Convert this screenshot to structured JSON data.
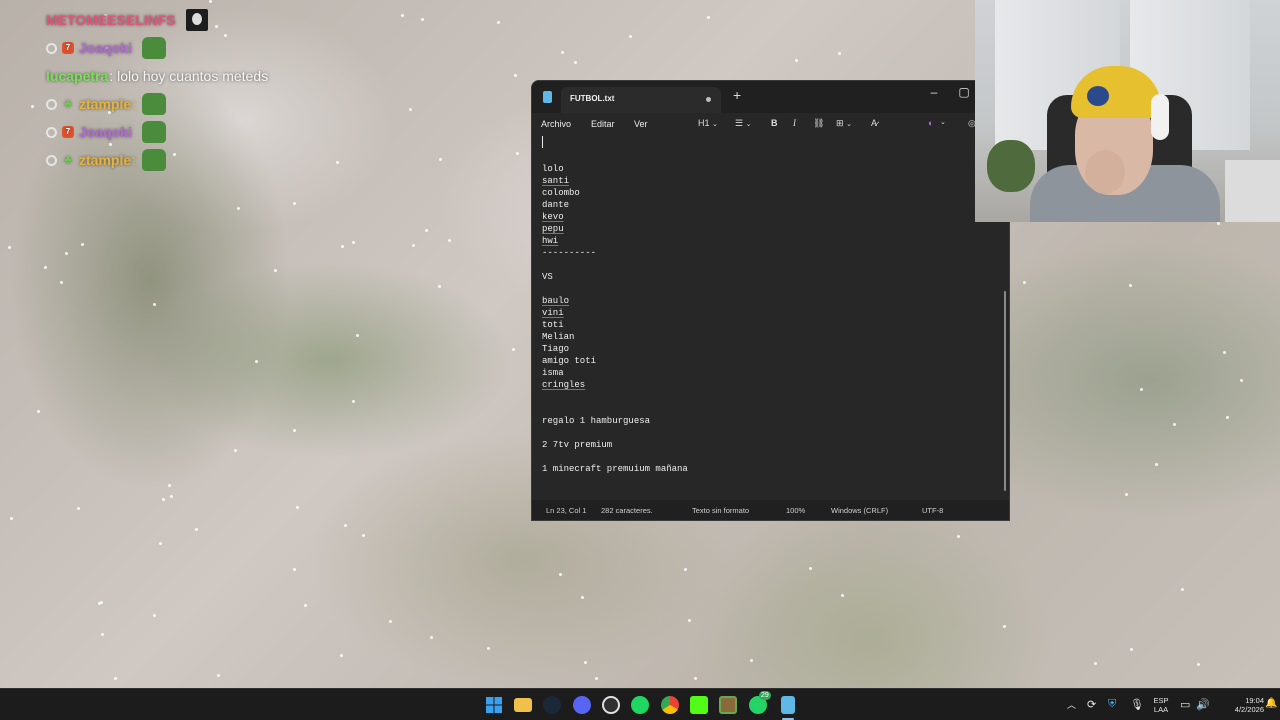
{
  "chat": [
    {
      "badges": [],
      "user": "METOMEESELINFS",
      "user_color": "#e2557a",
      "message": "",
      "emote": "dark"
    },
    {
      "badges": [
        "circle",
        "7tv"
      ],
      "user": "Joaqoki",
      "user_color": "#b26ad6",
      "message": "",
      "emote": "green"
    },
    {
      "badges": [],
      "user": "lucapetra",
      "user_color": "#7ae05a",
      "message": "lolo hoy cuantos meteds",
      "emote": ""
    },
    {
      "badges": [
        "circle",
        "leaf"
      ],
      "user": "ztample",
      "user_color": "#e6b43a",
      "message": "",
      "emote": "green"
    },
    {
      "badges": [
        "circle",
        "7tv"
      ],
      "user": "Joaqoki",
      "user_color": "#b26ad6",
      "message": "",
      "emote": "green"
    },
    {
      "badges": [
        "circle",
        "leaf"
      ],
      "user": "ztample",
      "user_color": "#e6b43a",
      "message": "",
      "emote": "green"
    }
  ],
  "notepad": {
    "tab_title": "FUTBOL.txt",
    "add_tab_icon": "+",
    "window_controls": {
      "minimize": "–",
      "maximize": "▢"
    },
    "menu": [
      "Archivo",
      "Editar",
      "Ver"
    ],
    "toolbar": {
      "heading": "H1",
      "list": "list-icon",
      "bold": "B",
      "italic": "I",
      "link": "link-icon",
      "table": "table-icon",
      "format_clear": "clear-format-icon",
      "copilot": "copilot-icon",
      "account": "account-icon"
    },
    "lines": [
      {
        "text": "",
        "spell": false
      },
      {
        "text": "",
        "spell": false
      },
      {
        "text": "lolo",
        "spell": false
      },
      {
        "text": "santi",
        "spell": true
      },
      {
        "text": "colombo",
        "spell": false
      },
      {
        "text": "dante",
        "spell": false
      },
      {
        "text": "kevo",
        "spell": true
      },
      {
        "text": "pepu",
        "spell": true
      },
      {
        "text": "hwi",
        "spell": true
      },
      {
        "text": "----------",
        "spell": false
      },
      {
        "text": "",
        "spell": false
      },
      {
        "text": "VS",
        "spell": false
      },
      {
        "text": "",
        "spell": false
      },
      {
        "text": "baulo",
        "spell": true
      },
      {
        "text": "vini",
        "spell": true
      },
      {
        "text": "toti",
        "spell": false
      },
      {
        "text": "Melian",
        "spell": false
      },
      {
        "text": "Tiago",
        "spell": false
      },
      {
        "text": "amigo toti",
        "spell": false
      },
      {
        "text": "isma",
        "spell": false
      },
      {
        "text": "cringles",
        "spell": true
      },
      {
        "text": "",
        "spell": false
      },
      {
        "text": "",
        "spell": false
      },
      {
        "text": "regalo 1 hamburguesa",
        "spell": false
      },
      {
        "text": "",
        "spell": false
      },
      {
        "text": "2 7tv premium",
        "spell": false
      },
      {
        "text": "",
        "spell": false
      },
      {
        "text": "1 minecraft premuium mañana",
        "spell": false
      }
    ],
    "status": {
      "position": "Ln 23, Col 1",
      "chars": "282 caracteres.",
      "format": "Texto sin formato",
      "zoom": "100%",
      "line_endings": "Windows (CRLF)",
      "encoding": "UTF-8"
    }
  },
  "taskbar": {
    "apps": [
      "windows-start-icon",
      "file-explorer-icon",
      "steam-icon",
      "discord-icon",
      "obs-icon",
      "spotify-icon",
      "chrome-icon",
      "kick-icon",
      "minecraft-icon",
      "whatsapp-icon",
      "notepad-icon"
    ],
    "whatsapp_badge": "29",
    "language": "ESP",
    "language_sub": "LAA",
    "time": "19:04",
    "date": "4/2/2026"
  }
}
